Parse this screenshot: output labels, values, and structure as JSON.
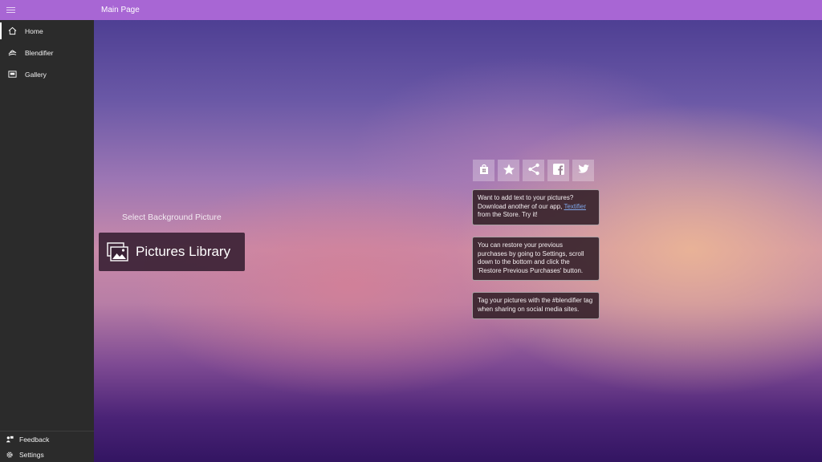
{
  "window": {
    "title": "Main Page"
  },
  "sidebar": {
    "items": [
      {
        "label": "Home",
        "icon": "home-icon",
        "active": true
      },
      {
        "label": "Blendifier",
        "icon": "blendifier-icon",
        "active": false
      },
      {
        "label": "Gallery",
        "icon": "gallery-icon",
        "active": false
      }
    ],
    "bottom": [
      {
        "label": "Feedback",
        "icon": "feedback-icon"
      },
      {
        "label": "Settings",
        "icon": "gear-icon"
      }
    ]
  },
  "main": {
    "select_label": "Select Background Picture",
    "pictures_button_label": "Pictures Library",
    "share_buttons": [
      "store-icon",
      "star-icon",
      "share-icon",
      "facebook-icon",
      "twitter-icon"
    ],
    "cards": {
      "textifier": {
        "before": "Want to add text to your pictures? Download another of our app, ",
        "link": "Textifier",
        "after": " from the Store. Try it!"
      },
      "restore": "You can restore your previous purchases by going to Settings, scroll down to the bottom and click the 'Restore Previous Purchases' button.",
      "tag": "Tag your pictures with the #blendifier tag when sharing on social media sites."
    }
  },
  "colors": {
    "titlebar": "#a866d4",
    "sidebar": "#2b2b2b",
    "link": "#7fa6e8"
  }
}
